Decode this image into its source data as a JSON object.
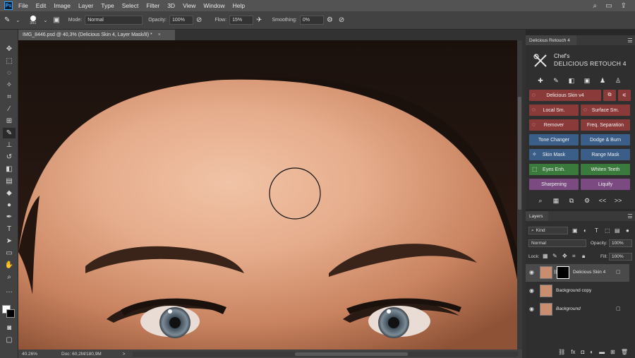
{
  "app": {
    "logo": "Ps"
  },
  "menu": [
    "File",
    "Edit",
    "Image",
    "Layer",
    "Type",
    "Select",
    "Filter",
    "3D",
    "View",
    "Window",
    "Help"
  ],
  "options": {
    "brush_size": "351",
    "mode_label": "Mode:",
    "mode_value": "Normal",
    "opacity_label": "Opacity:",
    "opacity_value": "100%",
    "flow_label": "Flow:",
    "flow_value": "15%",
    "smoothing_label": "Smoothing:",
    "smoothing_value": "0%"
  },
  "document": {
    "tab_title": "IMG_8446.psd @ 40,3% (Delicious Skin 4, Layer Mask/8) *",
    "close_glyph": "×"
  },
  "status": {
    "zoom": "40.26%",
    "doc_info": "Doc: 60,2M/180,9M",
    "arrow": ">"
  },
  "retouch": {
    "tab_label": "Delicious Retouch 4",
    "chef": "Chef's",
    "title": "DELICIOUS RETOUCH 4",
    "buttons": [
      {
        "label": "Delicious Skin v4",
        "color": "red"
      },
      {
        "label": "Local Sm.",
        "color": "red"
      },
      {
        "label": "Surface Sm.",
        "color": "red"
      },
      {
        "label": "Remover",
        "color": "red"
      },
      {
        "label": "Freq. Separation",
        "color": "red"
      },
      {
        "label": "Tone Changer",
        "color": "blue"
      },
      {
        "label": "Dodge & Burn",
        "color": "blue"
      },
      {
        "label": "Skin Mask",
        "color": "blue"
      },
      {
        "label": "Range Mask",
        "color": "blue"
      },
      {
        "label": "Eyes Enh.",
        "color": "green"
      },
      {
        "label": "Whiten Teeth",
        "color": "green"
      },
      {
        "label": "Sharpening",
        "color": "purple"
      },
      {
        "label": "Liquify",
        "color": "purple"
      }
    ],
    "nav_prev": "<<",
    "nav_next": ">>"
  },
  "layers": {
    "tab_label": "Layers",
    "kind_value": "Kind",
    "blend_value": "Normal",
    "opacity_label": "Opacity:",
    "opacity_value": "100%",
    "lock_label": "Lock:",
    "fill_label": "Fill:",
    "fill_value": "100%",
    "items": [
      {
        "name": "Delicious Skin 4",
        "has_mask": true,
        "selected": true
      },
      {
        "name": "Background copy",
        "has_mask": false,
        "selected": false
      },
      {
        "name": "Background",
        "has_mask": false,
        "selected": false,
        "italic": true
      }
    ]
  },
  "colors": {
    "ui_dark": "#282828",
    "panel": "#2f2f2f",
    "button_red": "#8b3a3a",
    "button_blue": "#3b5e89",
    "button_green": "#3b7a3d",
    "button_purple": "#7a4a80",
    "accent_blue": "#31a8ff"
  }
}
